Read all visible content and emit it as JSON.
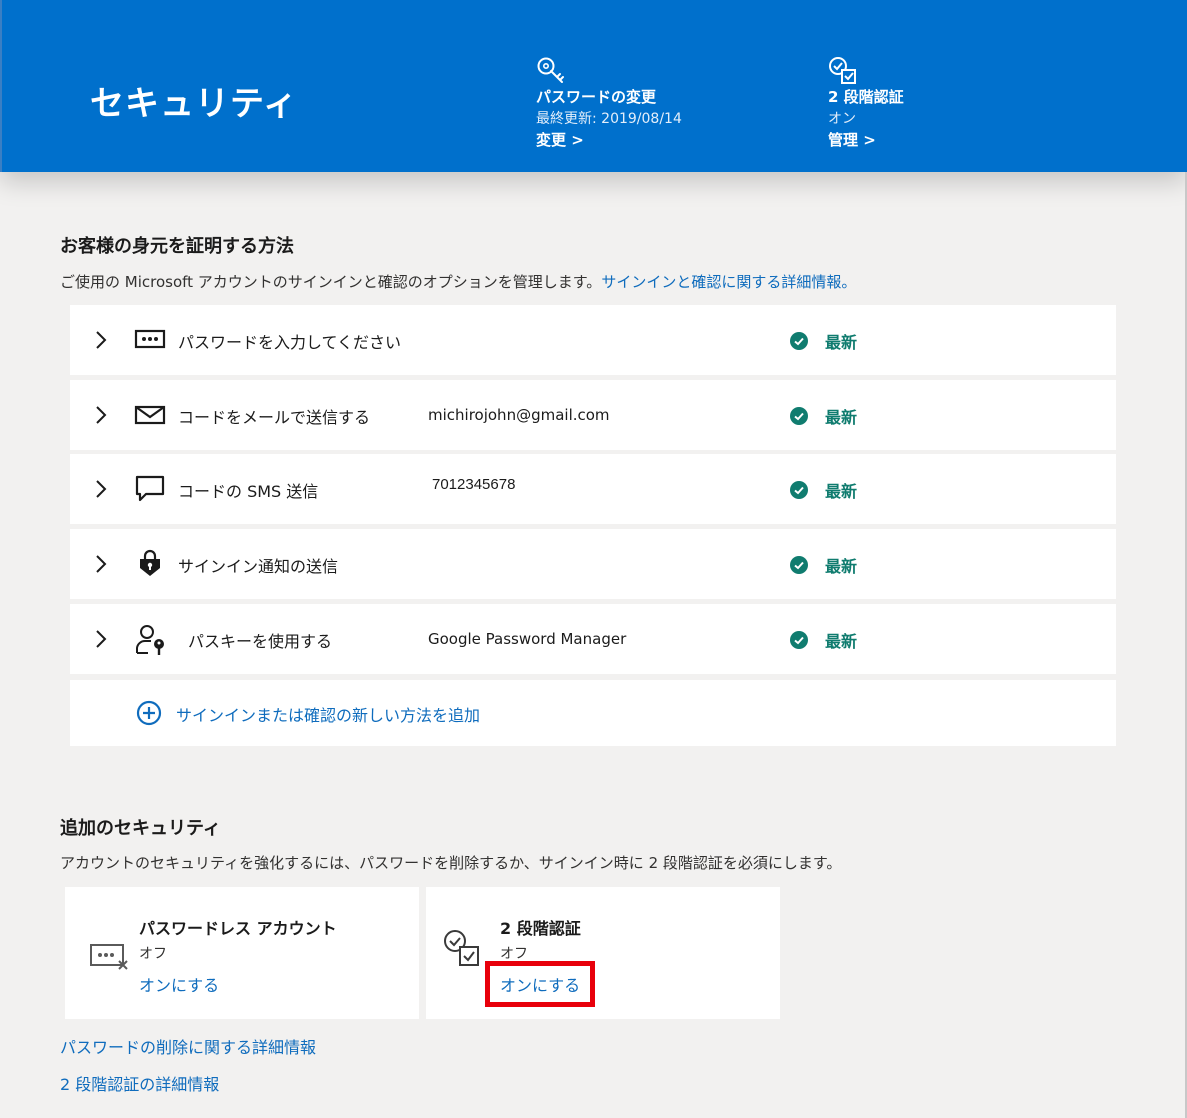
{
  "header": {
    "title": "セキュリティ",
    "password": {
      "name": "パスワードの変更",
      "sub": "最終更新: 2019/08/14",
      "link": "変更 >"
    },
    "two_step": {
      "name": "2 段階認証",
      "sub": "オン",
      "link": "管理 >"
    },
    "background_color": "#0070cc"
  },
  "identity": {
    "title": "お客様の身元を証明する方法",
    "desc": "ご使用の Microsoft アカウントのサインインと確認のオプションを管理します。",
    "desc_link": "サインインと確認に関する詳細情報。",
    "methods": [
      {
        "label": "パスワードを入力してください",
        "detail": "",
        "status": "最新",
        "icon": "password-dots-icon"
      },
      {
        "label": "コードをメールで送信する",
        "detail": "michirojohn@gmail.com",
        "status": "最新",
        "icon": "envelope-icon"
      },
      {
        "label": "コードの SMS 送信",
        "detail": "7012345678",
        "status": "最新",
        "icon": "chat-bubble-icon"
      },
      {
        "label": "サインイン通知の送信",
        "detail": "",
        "status": "最新",
        "icon": "lock-shield-icon"
      },
      {
        "label": "パスキーを使用する",
        "detail": "Google Password Manager",
        "status": "最新",
        "icon": "person-key-icon"
      }
    ],
    "add_method": "サインインまたは確認の新しい方法を追加",
    "status_color": "#107c6f"
  },
  "additional": {
    "title": "追加のセキュリティ",
    "desc": "アカウントのセキュリティを強化するには、パスワードを削除するか、サインイン時に 2 段階認証を必須にします。",
    "cards": [
      {
        "title": "パスワードレス アカウント",
        "state": "オフ",
        "action": "オンにする",
        "icon": "passwordless-icon"
      },
      {
        "title": "2 段階認証",
        "state": "オフ",
        "action": "オンにする",
        "icon": "two-step-icon"
      }
    ],
    "links": [
      "パスワードの削除に関する詳細情報",
      "2 段階認証の詳細情報"
    ],
    "highlight_color": "#e8000b"
  }
}
